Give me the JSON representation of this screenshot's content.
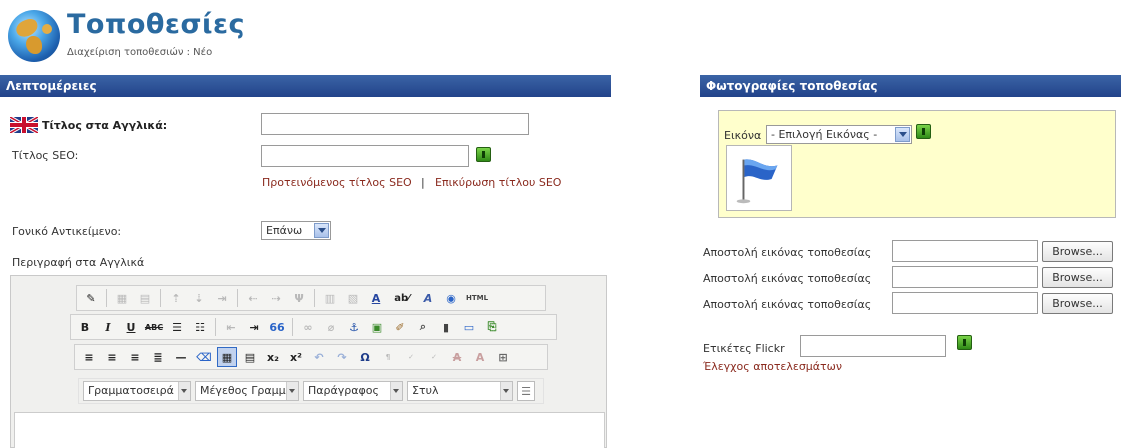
{
  "header": {
    "title": "Τοποθεσίες",
    "subtitle": "Διαχείριση τοποθεσιών : Νέο"
  },
  "left_panel": {
    "heading": "Λεπτομέρειες",
    "title_en_label": "Τίτλος στα Αγγλικά:",
    "title_en_value": "",
    "seo_label": "Τίτλος SEO:",
    "seo_value": "",
    "suggested_seo_link": "Προτεινόμενος τίτλος SEO",
    "link_separator": "|",
    "validate_seo_link": "Επικύρωση τίτλου SEO",
    "parent_label": "Γονικό Αντικείμενο:",
    "parent_value": "Επάνω",
    "description_label": "Περιγραφή στα Αγγλικά"
  },
  "editor": {
    "row2": {
      "bold": "B",
      "italic": "I",
      "underline": "U",
      "strike": "ABC",
      "quote": "66"
    },
    "row3": {
      "sub": "x₂",
      "sup": "x²",
      "omega": "Ω"
    },
    "row4": {
      "font_family": "Γραμματοσειρά",
      "font_size": "Μέγεθος Γραμμ",
      "format": "Παράγραφος",
      "style": "Στυλ"
    }
  },
  "right_panel": {
    "heading": "Φωτογραφίες τοποθεσίας",
    "image_label": "Εικόνα",
    "image_select": "- Επιλογή Εικόνας -",
    "upload_rows": [
      {
        "label": "Αποστολή εικόνας τοποθεσίας",
        "button": "Browse..."
      },
      {
        "label": "Αποστολή εικόνας τοποθεσίας",
        "button": "Browse..."
      },
      {
        "label": "Αποστολή εικόνας τοποθεσίας",
        "button": "Browse..."
      }
    ],
    "flickr_label": "Ετικέτες Flickr",
    "flickr_value": "",
    "check_results_link": "Έλεγχος αποτελεσμάτων"
  },
  "colors": {
    "bar": "#2c4f95",
    "title": "#2a6aa0",
    "link": "#8a2a1e",
    "image_box": "#ffffcc",
    "green_button": "#4caf2a"
  }
}
